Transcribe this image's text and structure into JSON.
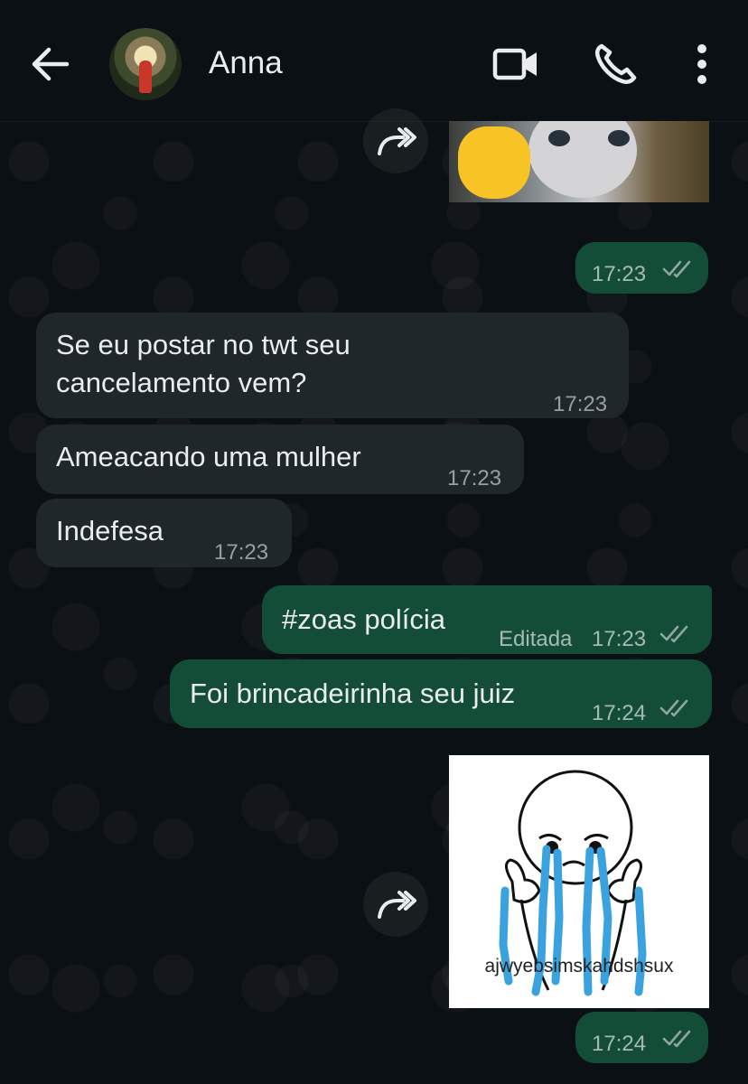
{
  "header": {
    "contact_name": "Anna",
    "icons": [
      "back-arrow-icon",
      "video-call-icon",
      "voice-call-icon",
      "more-options-icon"
    ]
  },
  "messages": [
    {
      "id": "m1",
      "direction": "outgoing",
      "type": "image",
      "time": "17:23",
      "status": "read",
      "forwardable": true
    },
    {
      "id": "m2",
      "direction": "incoming",
      "text_lines": [
        "Se eu postar no twt seu",
        "cancelamento vem?"
      ],
      "time": "17:23"
    },
    {
      "id": "m3",
      "direction": "incoming",
      "text": "Ameacando uma mulher",
      "time": "17:23"
    },
    {
      "id": "m4",
      "direction": "incoming",
      "text": "Indefesa",
      "time": "17:23"
    },
    {
      "id": "m5",
      "direction": "outgoing",
      "text": "#zoas polícia",
      "edited_label": "Editada",
      "time": "17:23",
      "status": "read"
    },
    {
      "id": "m6",
      "direction": "outgoing",
      "text": "Foi brincadeirinha seu juiz",
      "time": "17:24",
      "status": "read"
    },
    {
      "id": "m7",
      "direction": "outgoing",
      "type": "image",
      "image_caption": "ajwyebsimskahdshsux",
      "time": "17:24",
      "status": "read",
      "forwardable": true
    }
  ],
  "colors": {
    "background": "#0b1014",
    "incoming_bubble": "#1f272a",
    "outgoing_bubble": "#144d37",
    "read_ticks": "#8fa7a0"
  }
}
